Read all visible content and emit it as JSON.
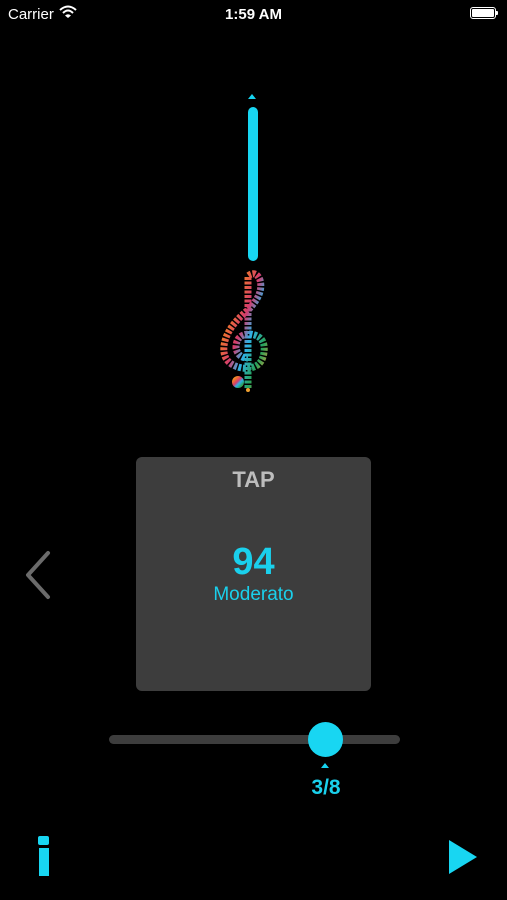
{
  "status_bar": {
    "carrier": "Carrier",
    "time": "1:59 AM"
  },
  "metronome": {
    "tap_label": "TAP",
    "bpm": "94",
    "tempo_name": "Moderato",
    "time_signature": "3/8"
  },
  "colors": {
    "accent": "#18d6f2",
    "panel": "#3d3d3d",
    "background": "#000000",
    "muted": "#bdbdbd"
  },
  "icons": {
    "wifi": "wifi-icon",
    "battery": "battery-icon",
    "clef": "treble-clef-icon",
    "prev": "chevron-left-icon",
    "info": "info-icon",
    "play": "play-icon"
  }
}
